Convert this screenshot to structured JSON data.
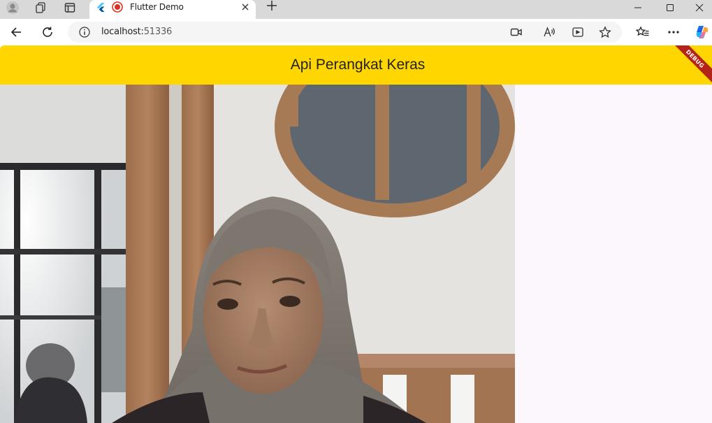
{
  "browser": {
    "tab": {
      "title": "Flutter Demo"
    },
    "url": {
      "host": "localhost:",
      "port": "51336"
    }
  },
  "app": {
    "title": "Api Perangkat Keras",
    "debug_banner": "DEBUG",
    "colors": {
      "appbar": "#ffd600",
      "background": "#fcf6fd",
      "debug_ribbon": "#b52418"
    }
  },
  "icons": [
    "profile-icon",
    "workspaces-icon",
    "vertical-tabs-icon",
    "flutter-favicon",
    "recording-icon",
    "close-icon",
    "plus-icon",
    "minimize-icon",
    "maximize-icon",
    "window-close-icon",
    "back-icon",
    "refresh-icon",
    "info-icon",
    "camera-icon",
    "read-aloud-icon",
    "app-available-icon",
    "star-icon",
    "favorites-icon",
    "more-icon",
    "copilot-icon"
  ]
}
